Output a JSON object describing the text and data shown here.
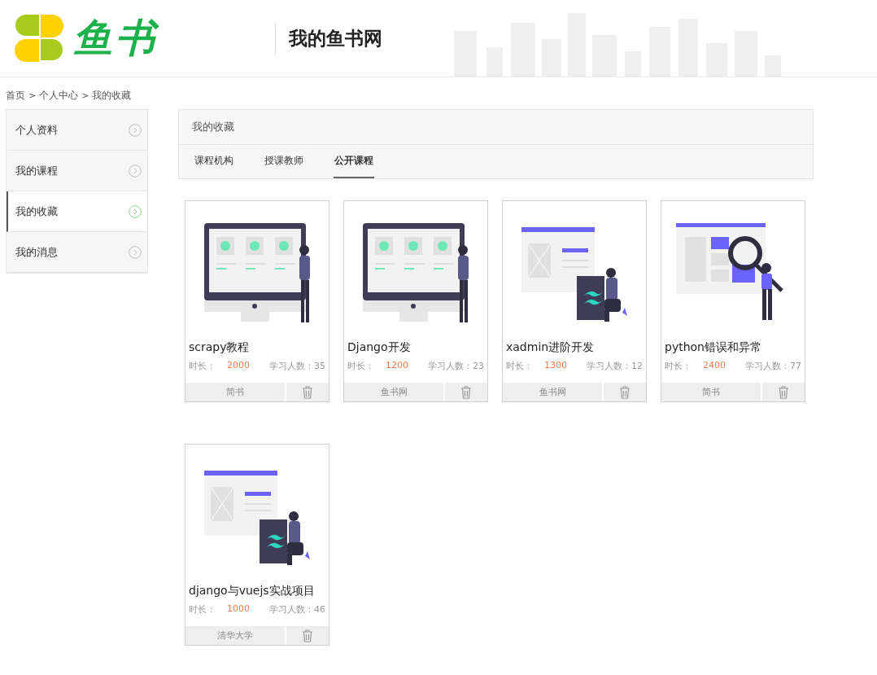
{
  "header": {
    "logo_text": "鱼书",
    "site_title": "我的鱼书网"
  },
  "breadcrumb": {
    "separator": ">",
    "items": [
      "首页",
      "个人中心",
      "我的收藏"
    ]
  },
  "sidebar": {
    "items": [
      {
        "label": "个人资料",
        "selected": false
      },
      {
        "label": "我的课程",
        "selected": false
      },
      {
        "label": "我的收藏",
        "selected": true
      },
      {
        "label": "我的消息",
        "selected": false
      }
    ]
  },
  "panel": {
    "title": "我的收藏",
    "tabs": [
      {
        "label": "课程机构",
        "selected": false
      },
      {
        "label": "授课教师",
        "selected": false
      },
      {
        "label": "公开课程",
        "selected": true
      }
    ]
  },
  "courses": [
    {
      "kind": "monitor",
      "title": "scrapy教程",
      "duration_label": "时长：",
      "duration": "2000",
      "students_label": "学习人数：",
      "students": "35",
      "org": "简书"
    },
    {
      "kind": "monitor",
      "title": "Django开发",
      "duration_label": "时长：",
      "duration": "1200",
      "students_label": "学习人数：",
      "students": "23",
      "org": "鱼书网"
    },
    {
      "kind": "tailwind",
      "title": "xadmin进阶开发",
      "duration_label": "时长：",
      "duration": "1300",
      "students_label": "学习人数：",
      "students": "12",
      "org": "鱼书网"
    },
    {
      "kind": "search",
      "title": "python错误和异常",
      "duration_label": "时长：",
      "duration": "2400",
      "students_label": "学习人数：",
      "students": "77",
      "org": "简书"
    },
    {
      "kind": "tailwind",
      "title": "django与vuejs实战项目",
      "duration_label": "时长：",
      "duration": "1000",
      "students_label": "学习人数：",
      "students": "46",
      "org": "清华大学"
    }
  ]
}
